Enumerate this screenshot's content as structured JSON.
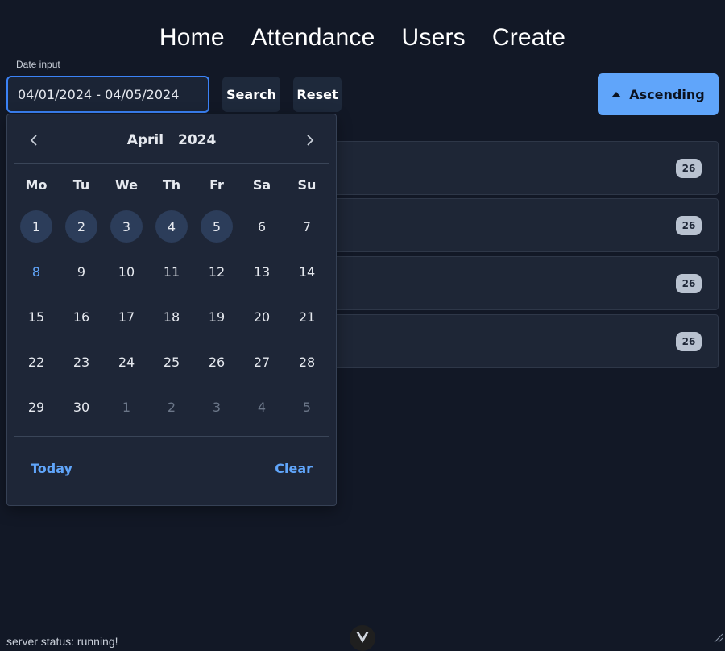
{
  "nav": {
    "items": [
      {
        "label": "Home"
      },
      {
        "label": "Attendance"
      },
      {
        "label": "Users"
      },
      {
        "label": "Create"
      }
    ]
  },
  "filter": {
    "label": "Date input",
    "value": "04/01/2024 - 04/05/2024",
    "search_label": "Search",
    "reset_label": "Reset",
    "sort_label": "Ascending",
    "sort_icon": "triangle-up-icon"
  },
  "list": {
    "rows": [
      {
        "badge": "26"
      },
      {
        "badge": "26"
      },
      {
        "badge": "26"
      },
      {
        "badge": "26"
      }
    ]
  },
  "calendar": {
    "month": "April",
    "year": "2024",
    "weekdays": [
      "Mo",
      "Tu",
      "We",
      "Th",
      "Fr",
      "Sa",
      "Su"
    ],
    "days": [
      {
        "label": "1",
        "selected": true
      },
      {
        "label": "2",
        "selected": true
      },
      {
        "label": "3",
        "selected": true
      },
      {
        "label": "4",
        "selected": true
      },
      {
        "label": "5",
        "selected": true
      },
      {
        "label": "6"
      },
      {
        "label": "7"
      },
      {
        "label": "8",
        "today": true
      },
      {
        "label": "9"
      },
      {
        "label": "10"
      },
      {
        "label": "11"
      },
      {
        "label": "12"
      },
      {
        "label": "13"
      },
      {
        "label": "14"
      },
      {
        "label": "15"
      },
      {
        "label": "16"
      },
      {
        "label": "17"
      },
      {
        "label": "18"
      },
      {
        "label": "19"
      },
      {
        "label": "20"
      },
      {
        "label": "21"
      },
      {
        "label": "22"
      },
      {
        "label": "23"
      },
      {
        "label": "24"
      },
      {
        "label": "25"
      },
      {
        "label": "26"
      },
      {
        "label": "27"
      },
      {
        "label": "28"
      },
      {
        "label": "29"
      },
      {
        "label": "30"
      },
      {
        "label": "1",
        "outside": true
      },
      {
        "label": "2",
        "outside": true
      },
      {
        "label": "3",
        "outside": true
      },
      {
        "label": "4",
        "outside": true
      },
      {
        "label": "5",
        "outside": true
      }
    ],
    "today_label": "Today",
    "clear_label": "Clear"
  },
  "status": {
    "text": "server status: running!"
  },
  "colors": {
    "background": "#121826",
    "accent": "#60a5fa",
    "input_border": "#3b82f6",
    "panel": "#1e2637"
  }
}
